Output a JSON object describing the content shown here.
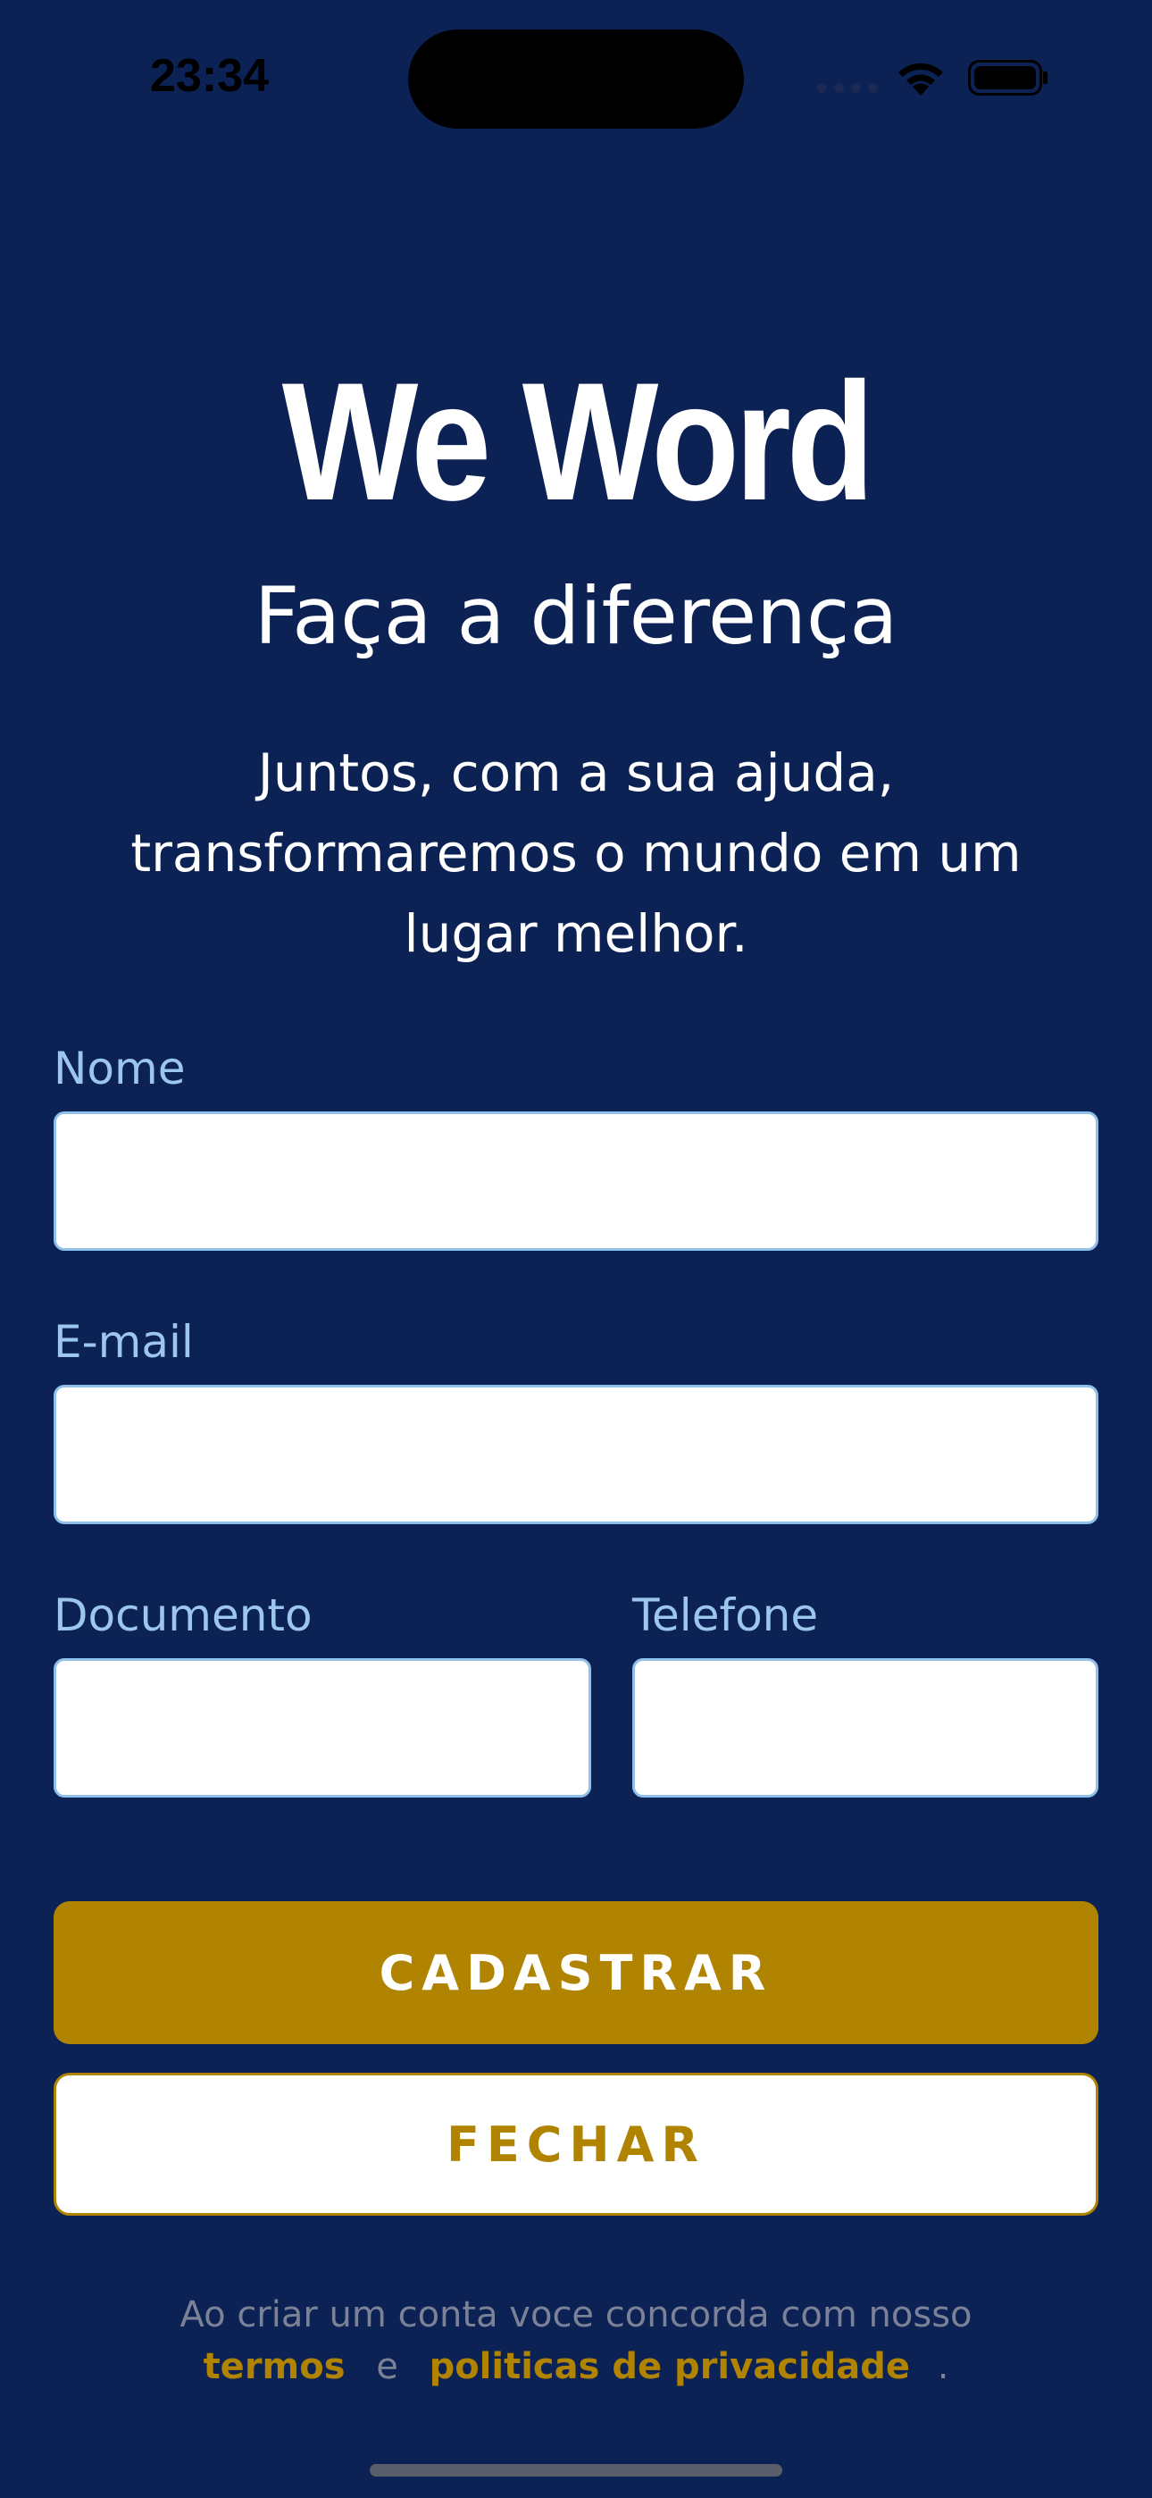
{
  "status_bar": {
    "time": "23:34"
  },
  "app": {
    "logo_text": "We Word",
    "headline": "Faça a diferença",
    "subtitle": "Juntos, com a sua ajuda, transformaremos o mundo em um lugar melhor."
  },
  "form": {
    "name_label": "Nome",
    "name_value": "",
    "email_label": "E-mail",
    "email_value": "",
    "document_label": "Documento",
    "document_value": "",
    "phone_label": "Telefone",
    "phone_value": ""
  },
  "actions": {
    "register_label": "CADASTRAR",
    "close_label": "FECHAR"
  },
  "footer": {
    "text": "Ao criar um conta voce concorda com nosso",
    "terms_link": "termos",
    "connector": "e",
    "privacy_link": "politicas de privacidade",
    "end": "."
  },
  "colors": {
    "background": "#0c2254",
    "accent": "#b08300",
    "label": "#9cc6ec"
  }
}
